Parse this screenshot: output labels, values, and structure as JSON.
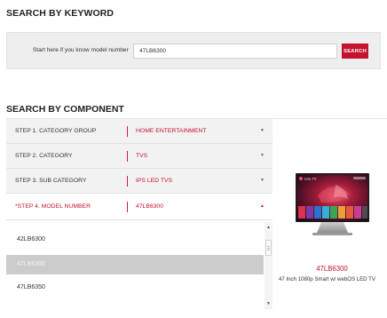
{
  "keyword_section": {
    "title": "SEARCH BY KEYWORD",
    "label": "Start here if you know model number",
    "input_value": "47LB6300",
    "search_button": "SEARCH"
  },
  "component_section": {
    "title": "SEARCH BY COMPONENT",
    "steps": [
      {
        "label": "STEP 1. CATEGORY GROUP",
        "value": "HOME ENTERTAINMENT",
        "arrow": "▼"
      },
      {
        "label": "STEP 2. CATEGORY",
        "value": "TVS",
        "arrow": "▼"
      },
      {
        "label": "STEP 3. SUB CATEGORY",
        "value": "IPS LED TVS",
        "arrow": "▼"
      },
      {
        "label": "*STEP 4. MODEL NUMBER",
        "value": "47LB6300",
        "arrow": "▲"
      }
    ],
    "model_options": [
      "42LB6300",
      "47LB6300",
      "47LB6350"
    ],
    "selected_option": "47LB6300",
    "scrollbar": {
      "up": "▲",
      "down": "▼"
    }
  },
  "product": {
    "model": "47LB6300",
    "description": "47 Inch 1080p Smart w/ webOS LED TV",
    "screen_text": "Live TV"
  },
  "colors": {
    "accent": "#c4132f",
    "keyword_box_bg": "#eeeeee",
    "step_bg": "#f2f2f2",
    "selected_option_bg": "#cccccc"
  }
}
